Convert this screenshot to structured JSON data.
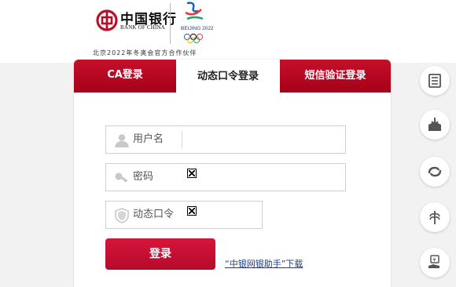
{
  "header": {
    "bank_name_cn": "中国银行",
    "bank_name_en": "BANK OF CHINA",
    "olympic_text": "BEIJING 2022",
    "partner_text": "北京2022年冬奥会官方合作伙伴"
  },
  "tabs": [
    {
      "label": "CA登录",
      "active": false
    },
    {
      "label": "动态口令登录",
      "active": true
    },
    {
      "label": "短信验证登录",
      "active": false
    }
  ],
  "form": {
    "username_placeholder": "用户名",
    "password_placeholder": "密码",
    "dynamic_code_placeholder": "动态口令"
  },
  "login_button": "登录",
  "helper_link": "“中银网银助手”下载",
  "side_tools": [
    "document-list-icon",
    "download-box-icon",
    "exchange-icon",
    "wheat-icon",
    "yuan-hand-icon"
  ],
  "colors": {
    "brand_red": "#c5102a",
    "link_blue": "#1a3c8f"
  }
}
